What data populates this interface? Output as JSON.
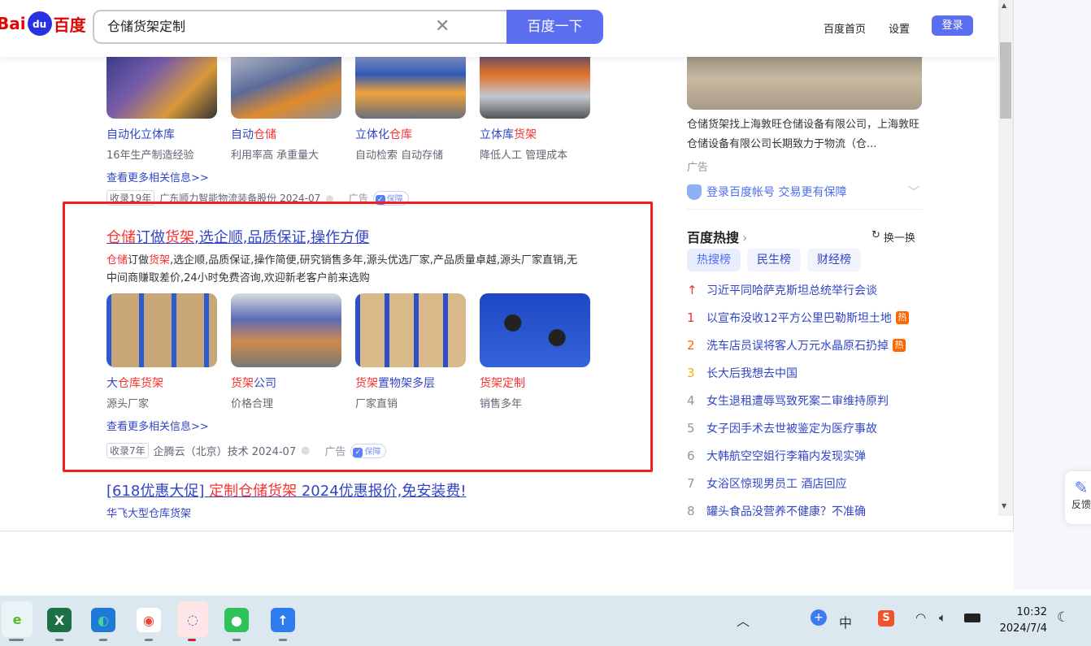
{
  "header": {
    "logo": "Bai du 百度",
    "search_value": "仓储货架定制",
    "search_button": "百度一下",
    "links": [
      "百度首页",
      "设置"
    ],
    "login": "登录"
  },
  "result1": {
    "items": [
      {
        "title_parts": [
          "自动化立体库",
          ""
        ],
        "desc": "16年生产制造经验"
      },
      {
        "title_parts": [
          "自动",
          "仓储"
        ],
        "desc": "利用率高 承重量大"
      },
      {
        "title_parts": [
          "立体化",
          "仓库"
        ],
        "desc": "自动检索 自动存储"
      },
      {
        "title_parts": [
          "立体库",
          "货架"
        ],
        "desc": "降低人工 管理成本"
      }
    ],
    "more": "查看更多相关信息>>",
    "meta": {
      "tag": "收录19年",
      "source": "广东顺力智能物流装备股份 2024-07",
      "ad": "广告",
      "badge": "保障"
    }
  },
  "result2": {
    "title": {
      "r1": "仓储",
      "b1": "订做",
      "r2": "货架",
      "b2": ",选企顺,品质保证,操作方便"
    },
    "desc": {
      "r1": "仓储",
      "b1": "订做",
      "r2": "货架",
      "rest": ",选企顺,品质保证,操作简便,研究销售多年,源头优选厂家,产品质量卓越,源头厂家直销,无中间商赚取差价,24小时免费咨询,欢迎新老客户前来选购"
    },
    "items": [
      {
        "a": "大",
        "r": "仓库货架",
        "b": "",
        "desc": "源头厂家"
      },
      {
        "a": "",
        "r": "货架",
        "b": "公司",
        "desc": "价格合理"
      },
      {
        "a": "",
        "r": "货架",
        "b": "置物架多层",
        "desc": "厂家直销"
      },
      {
        "a": "",
        "r": "货架定制",
        "b": "",
        "desc": "销售多年"
      }
    ],
    "more": "查看更多相关信息>>",
    "meta": {
      "tag": "收录7年",
      "source": "企腾云（北京）技术 2024-07",
      "ad": "广告",
      "badge": "保障"
    }
  },
  "result3": {
    "title": {
      "b1": "[618优惠大促] ",
      "r": "定制仓储货架",
      "b2": " 2024优惠报价,免安装费!"
    },
    "sub": "华飞大型仓库货架"
  },
  "sidebar": {
    "ad_text": "仓储货架找上海敦旺仓储设备有限公司，上海敦旺仓储设备有限公司长期致力于物流（仓...",
    "ad_label": "广告",
    "login_tip": "登录百度帐号 交易更有保障",
    "hot_title": "百度热搜",
    "refresh": "换一换",
    "tabs": [
      "热搜榜",
      "民生榜",
      "财经榜"
    ],
    "hot": [
      {
        "rank": "↑",
        "title": "习近平同哈萨克斯坦总统举行会谈",
        "hot": ""
      },
      {
        "rank": "1",
        "title": "以宣布没收12平方公里巴勒斯坦土地",
        "hot": "热"
      },
      {
        "rank": "2",
        "title": "洗车店员误将客人万元水晶原石扔掉",
        "hot": "热"
      },
      {
        "rank": "3",
        "title": "长大后我想去中国",
        "hot": ""
      },
      {
        "rank": "4",
        "title": "女生退租遭辱骂致死案二审维持原判",
        "hot": ""
      },
      {
        "rank": "5",
        "title": "女子因手术去世被鉴定为医疗事故",
        "hot": ""
      },
      {
        "rank": "6",
        "title": "大韩航空空姐行李箱内发现实弹",
        "hot": ""
      },
      {
        "rank": "7",
        "title": "女浴区惊现男员工 酒店回应",
        "hot": ""
      },
      {
        "rank": "8",
        "title": "罐头食品没营养不健康？不准确",
        "hot": ""
      }
    ],
    "rank_colors": [
      "#f73131",
      "#f73131",
      "#ff6600",
      "#faa90e",
      "#9195a3"
    ]
  },
  "feedback": "反馈",
  "taskbar": {
    "ime": "中",
    "time": "10:32",
    "date": "2024/7/4",
    "apps": [
      "ie-browser",
      "excel",
      "edge",
      "chrome",
      "wecom",
      "wechat",
      "app"
    ]
  }
}
